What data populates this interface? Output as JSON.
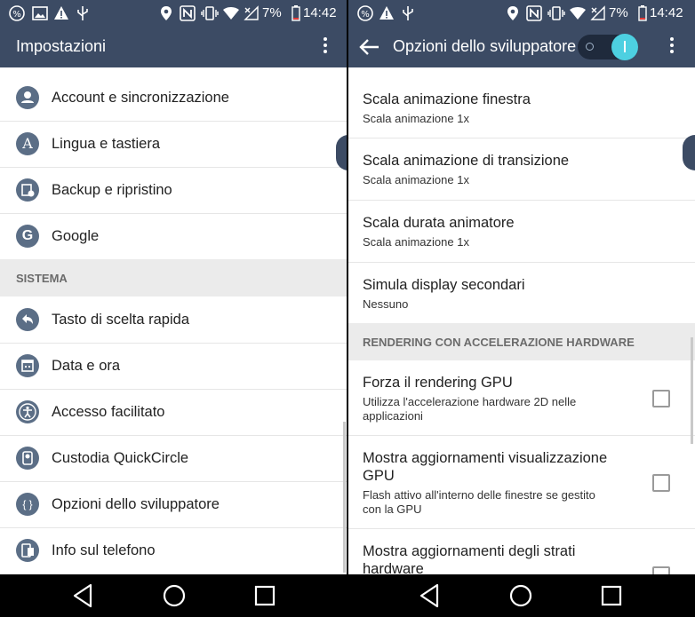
{
  "status": {
    "battery": "7%",
    "time": "14:42"
  },
  "left": {
    "title": "Impostazioni",
    "items_top": [
      {
        "label": "Account e sincronizzazione",
        "icon": "account-icon"
      },
      {
        "label": "Lingua e tastiera",
        "icon": "language-icon"
      },
      {
        "label": "Backup e ripristino",
        "icon": "backup-icon"
      },
      {
        "label": "Google",
        "icon": "google-icon"
      }
    ],
    "section": "SISTEMA",
    "items_bottom": [
      {
        "label": "Tasto di scelta rapida",
        "icon": "shortcut-key-icon"
      },
      {
        "label": "Data e ora",
        "icon": "calendar-icon"
      },
      {
        "label": "Accesso facilitato",
        "icon": "accessibility-icon"
      },
      {
        "label": "Custodia QuickCircle",
        "icon": "quickcircle-icon"
      },
      {
        "label": "Opzioni dello sviluppatore",
        "icon": "developer-icon"
      },
      {
        "label": "Info sul telefono",
        "icon": "phone-info-icon"
      }
    ]
  },
  "right": {
    "title": "Opzioni dello sviluppatore",
    "items": [
      {
        "title": "Scala animazione finestra",
        "sub": "Scala animazione 1x"
      },
      {
        "title": "Scala animazione di transizione",
        "sub": "Scala animazione 1x"
      },
      {
        "title": "Scala durata animatore",
        "sub": "Scala animazione 1x"
      },
      {
        "title": "Simula display secondari",
        "sub": "Nessuno"
      }
    ],
    "section": "RENDERING CON ACCELERAZIONE HARDWARE",
    "checks": [
      {
        "title": "Forza il rendering GPU",
        "sub1": "Utilizza l'accelerazione hardware 2D nelle",
        "sub2": "applicazioni"
      },
      {
        "title1": "Mostra aggiornamenti visualizzazione",
        "title2": "GPU",
        "sub1": "Flash attivo all'interno delle finestre se gestito",
        "sub2": "con la GPU"
      },
      {
        "title1": "Mostra aggiornamenti degli strati",
        "title2": "hardware"
      }
    ]
  },
  "colors": {
    "bar": "#3c4b64",
    "toggle": "#4dd0e1"
  }
}
